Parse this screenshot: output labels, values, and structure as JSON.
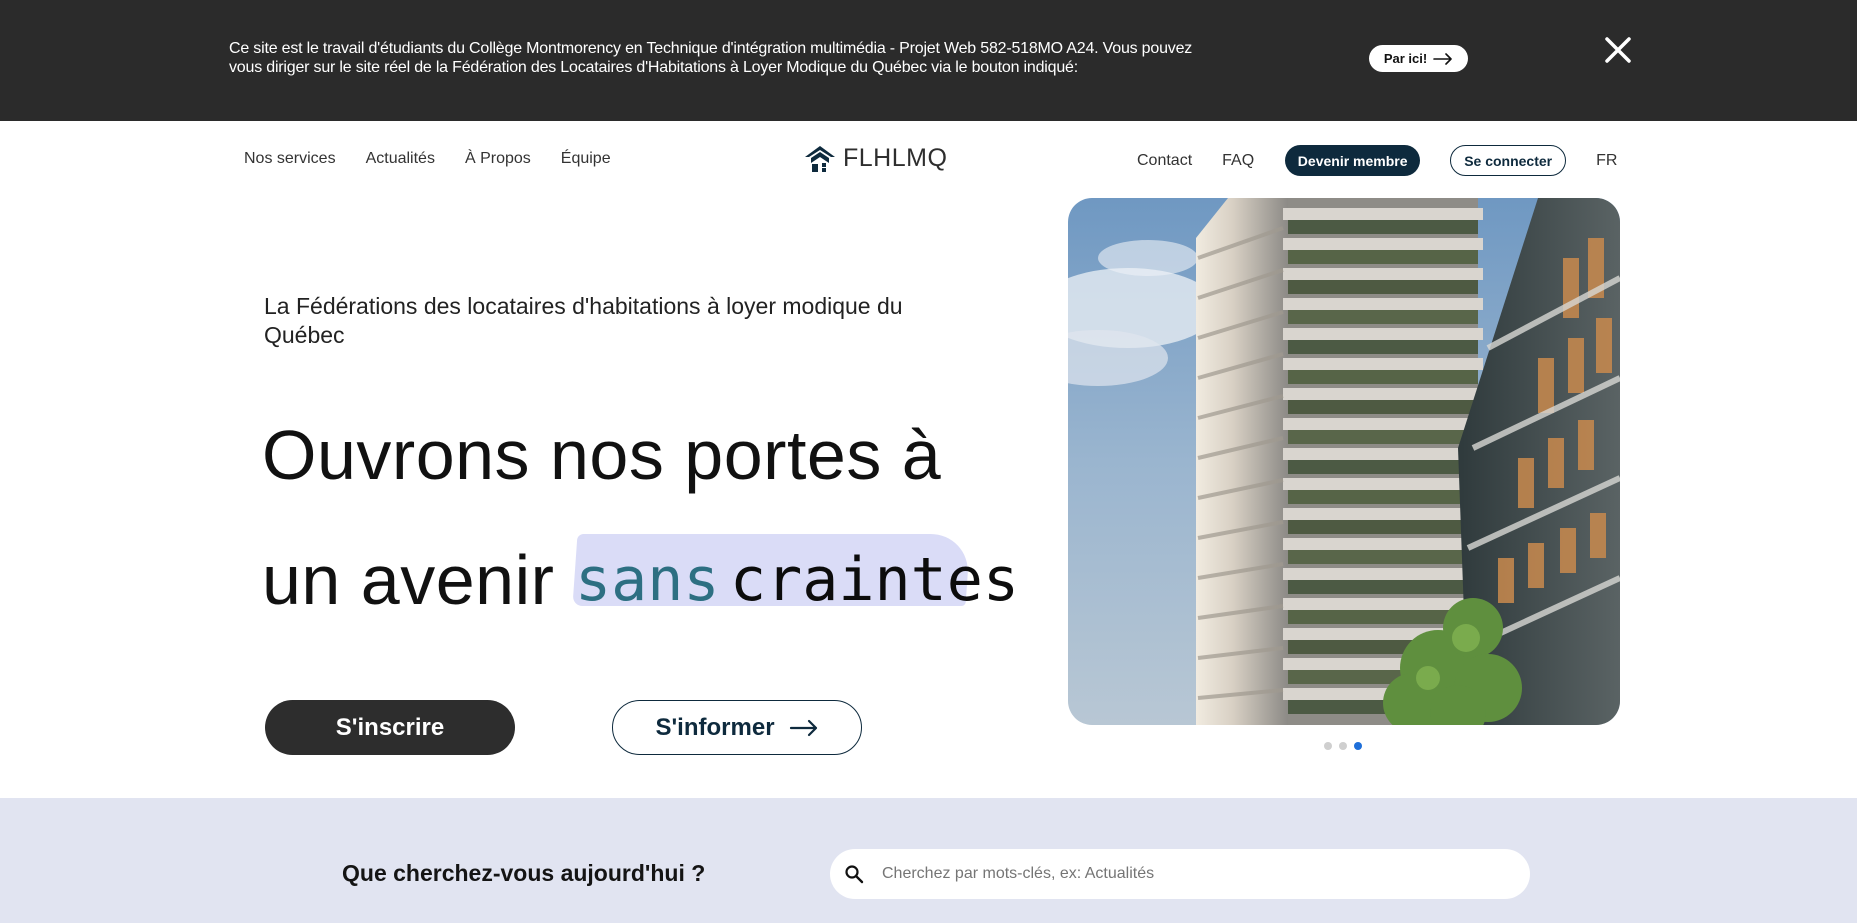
{
  "notice": {
    "text": "Ce site est le travail d'étudiants du Collège Montmorency en Technique d'intégration multimédia - Projet Web 582-518MO A24. Vous pouvez vous diriger sur le site réel de la Fédération des Locataires d'Habitations à Loyer Modique du Québec via le bouton indiqué:",
    "button_label": "Par ici!",
    "button_icon": "arrow-right-icon",
    "close_icon": "close-icon"
  },
  "nav": {
    "left_items": [
      "Nos services",
      "Actualités",
      "À Propos",
      "Équipe"
    ],
    "logo_text": "FLHLMQ",
    "logo_icon": "house-roof-icon",
    "contact_label": "Contact",
    "faq_label": "FAQ",
    "member_label": "Devenir membre",
    "login_label": "Se connecter",
    "lang_label": "FR"
  },
  "hero": {
    "kicker": "La Fédérations des locataires d'habitations à loyer modique du Québec",
    "line1": "Ouvrons nos portes à",
    "line2_prefix": "un avenir",
    "highlight_word1": "sans",
    "highlight_word2": "craintes",
    "primary_button": "S'inscrire",
    "secondary_button": "S'informer",
    "secondary_icon": "arrow-right-icon",
    "carousel": {
      "total": 3,
      "active_index": 2
    }
  },
  "search": {
    "title": "Que cherchez-vous aujourd'hui ?",
    "placeholder": "Cherchez par mots-clés, ex: Actualités",
    "value": "",
    "icon": "search-icon"
  },
  "colors": {
    "banner_bg": "#2b2b2b",
    "navy": "#0e2a3d",
    "highlight": "#dadcf7",
    "teal_script": "#2d6f82",
    "search_band": "#e1e4f1",
    "active_dot": "#1e6fd9"
  }
}
